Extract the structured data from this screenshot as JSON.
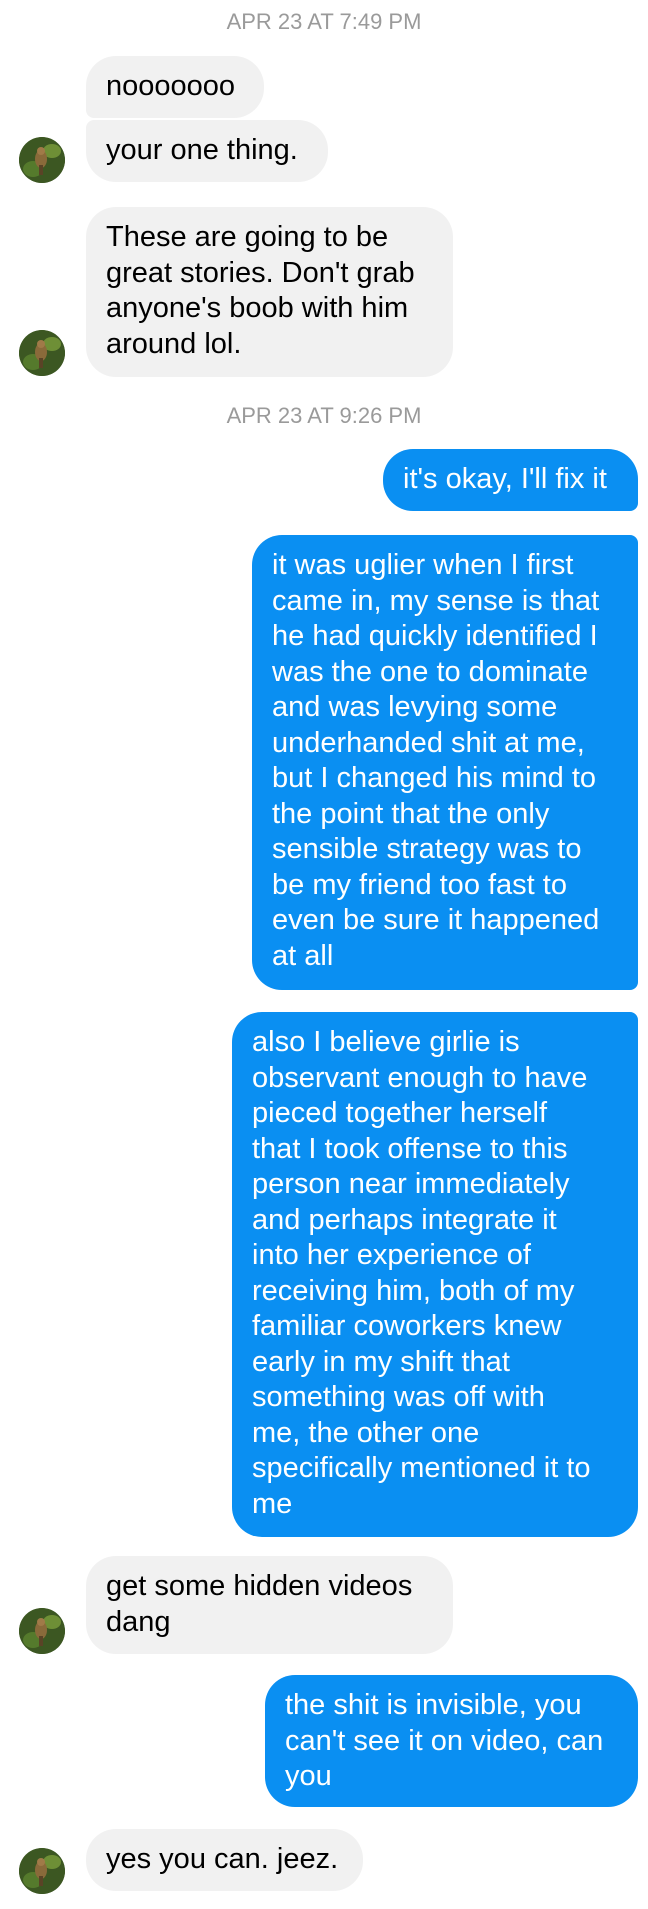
{
  "thread": {
    "timestamps": [
      "APR 23 AT 7:49 PM",
      "APR 23 AT 9:26 PM"
    ],
    "messages": [
      {
        "from": "contact",
        "text": "nooooooo"
      },
      {
        "from": "contact",
        "text": "your one thing."
      },
      {
        "from": "contact",
        "text": "These are going to be\ngreat stories. Don't grab\nanyone's boob with him\naround lol."
      },
      {
        "from": "me",
        "text": "it's okay, I'll fix it"
      },
      {
        "from": "me",
        "text": "it was uglier when I first\ncame in, my sense is that\nhe had quickly identified I\nwas the one to dominate\nand was levying some\nunderhanded shit at me,\nbut I changed his mind to\nthe point that the only\nsensible strategy was to\nbe my friend too fast to\neven be sure it happened\nat all"
      },
      {
        "from": "me",
        "text": "also I believe girlie is\nobservant enough to have\npieced together herself\nthat I took offense to this\nperson near immediately\nand perhaps integrate it\ninto her experience of\nreceiving him, both of my\nfamiliar coworkers knew\nearly in my shift that\nsomething was off with\nme, the other one\nspecifically mentioned it to\nme"
      },
      {
        "from": "contact",
        "text": "get some hidden videos\ndang"
      },
      {
        "from": "me",
        "text": "the shit is invisible, you\ncan't see it on video, can\nyou"
      },
      {
        "from": "contact",
        "text": "yes you can. jeez."
      }
    ]
  },
  "colors": {
    "incoming_bubble": "#f1f1f1",
    "outgoing_bubble": "#0a8ff2",
    "timestamp_text": "#9a9a9a"
  },
  "icons": {
    "contact_avatar": "avatar-photo"
  }
}
